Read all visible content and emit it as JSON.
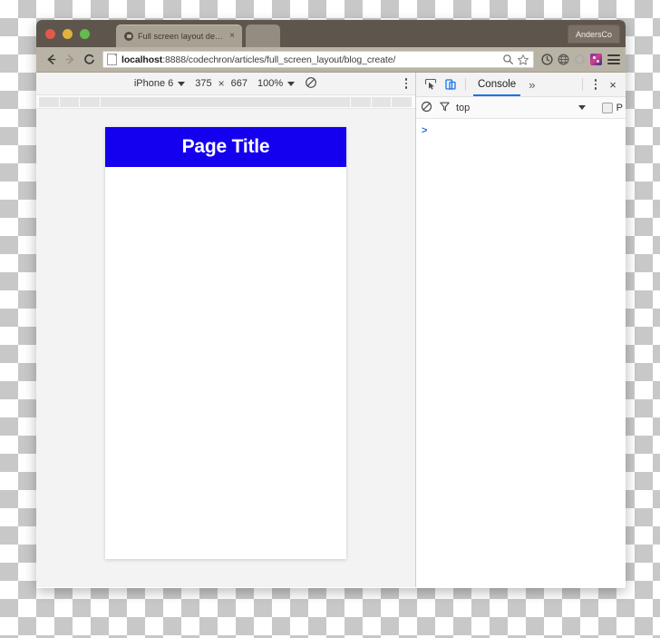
{
  "window": {
    "traffic_lights": [
      "close",
      "minimize",
      "zoom"
    ],
    "profile_label": "AndersCo"
  },
  "tabs": [
    {
      "title": "Full screen layout demo",
      "close_label": "×",
      "active": true
    },
    {
      "title": "",
      "close_label": "",
      "active": false
    }
  ],
  "toolbar": {
    "back_label": "Back",
    "forward_label": "Forward",
    "reload_label": "C",
    "url_host": "localhost",
    "url_rest": ":8888/codechron/articles/full_screen_layout/blog_create/",
    "icons": [
      "search-icon",
      "bookmark-star-icon",
      "extension-clock-icon",
      "extension-globe-icon",
      "extension-circle-icon",
      "extension-avatar-icon",
      "menu-icon"
    ]
  },
  "device_toolbar": {
    "device_name": "iPhone 6",
    "width": "375",
    "separator": "×",
    "height": "667",
    "zoom": "100%",
    "throttle_label": "No throttling",
    "menu_label": "More options"
  },
  "page": {
    "title": "Page Title",
    "banner_color": "#1400ee",
    "banner_text_color": "#ffffff",
    "body_color": "#ffffff"
  },
  "devtools": {
    "inspect_label": "Inspect element",
    "device_toggle_label": "Toggle device toolbar",
    "tabs": [
      {
        "label": "Console",
        "active": true
      }
    ],
    "more_tabs_label": "»",
    "menu_label": "Customize and control DevTools",
    "close_label": "×",
    "filter_bar": {
      "clear_label": "Clear console",
      "filter_label": "Filter",
      "context": "top",
      "preserve_log_label": "P"
    },
    "console_prompt": ">"
  }
}
